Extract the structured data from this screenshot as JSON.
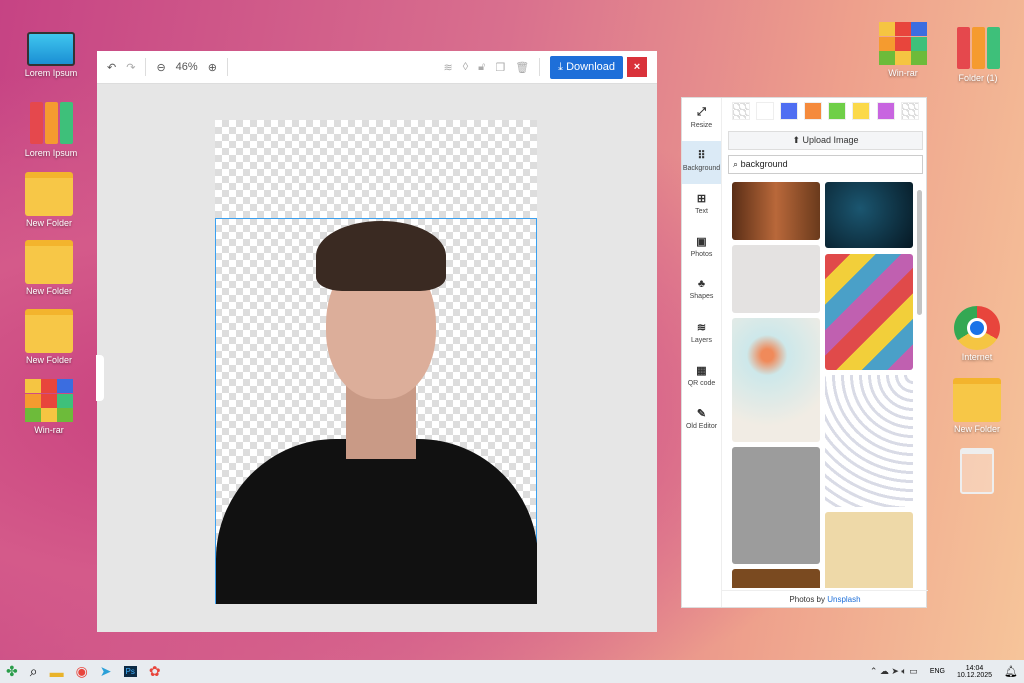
{
  "desktop": {
    "left_icons": [
      "Lorem Ipsum",
      "Lorem Ipsum",
      "New Folder",
      "New Folder",
      "New Folder",
      "Win-rar"
    ],
    "right_icons": [
      "Win-rar",
      "Folder (1)",
      "Internet",
      "New Folder"
    ]
  },
  "toolbar": {
    "zoom": "46%",
    "download": "Download",
    "close": "×"
  },
  "panel": {
    "nav": [
      "Resize",
      "Background",
      "Text",
      "Photos",
      "Shapes",
      "Layers",
      "QR code",
      "Old Editor"
    ],
    "swatches": [
      "#ffffff",
      "#4f6ef2",
      "#f58a3c",
      "#6fcf48",
      "#fbd94a",
      "#c865e0"
    ],
    "upload": "Upload Image",
    "search": "background",
    "footer_prefix": "Photos by",
    "footer_link": "Unsplash"
  },
  "taskbar": {
    "lang": "ENG",
    "time": "14:04",
    "date": "10.12.2025"
  }
}
